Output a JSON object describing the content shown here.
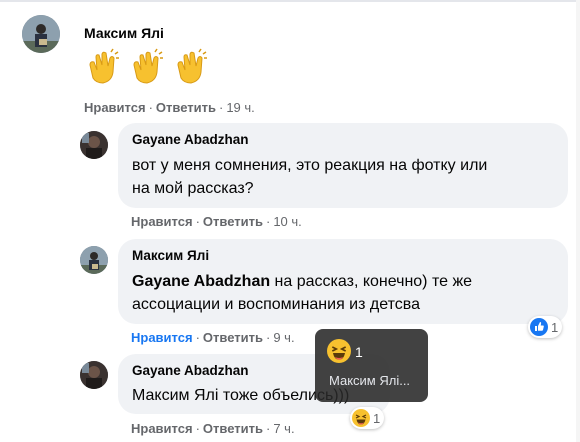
{
  "comments": [
    {
      "author": "Максим Ялі",
      "emoji": [
        "clapping-hands",
        "clapping-hands",
        "clapping-hands"
      ],
      "like": "Нравится",
      "reply": "Ответить",
      "time": "19 ч."
    },
    {
      "author": "Gayane Abadzhan",
      "line1": "вот у меня сомнения, это реакция на фотку или",
      "line2": "на мой рассказ?",
      "like": "Нравится",
      "reply": "Ответить",
      "time": "10 ч."
    },
    {
      "author": "Максим Ялі",
      "mention": "Gayane Abadzhan",
      "line1_rest": " на рассказ, конечно) те же",
      "line2": "ассоциации и воспоминания из детсва",
      "like": "Нравится",
      "reply": "Ответить",
      "time": "9 ч.",
      "reaction": {
        "icon": "like-icon",
        "count": "1"
      }
    },
    {
      "author": "Gayane Abadzhan",
      "line1": "Максим Ялі тоже объелись)))",
      "like": "Нравится",
      "reply": "Ответить",
      "time": "7 ч.",
      "reaction": {
        "icon": "haha-icon",
        "count": "1"
      }
    }
  ],
  "tooltip": {
    "icon": "haha-icon",
    "count": "1",
    "name": "Максим Ялі..."
  },
  "colors": {
    "bubble": "#f0f2f5",
    "meta": "#65676b",
    "accent": "#1877f2"
  }
}
